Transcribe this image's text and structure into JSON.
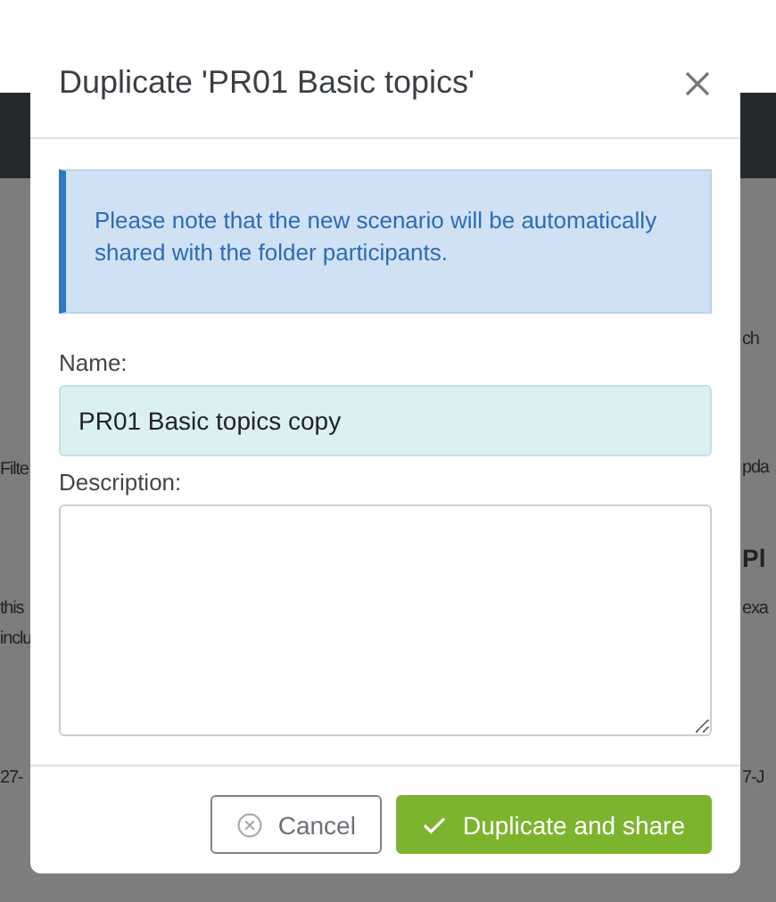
{
  "background": {
    "left_texts": [
      {
        "text": "Filte"
      },
      {
        "text": "this"
      },
      {
        "text": "inclu"
      },
      {
        "text": "27-"
      }
    ],
    "right_texts": [
      {
        "text": "ch",
        "kind": "plain"
      },
      {
        "text": "pda",
        "kind": "plain"
      },
      {
        "text": "Pl",
        "kind": "heading"
      },
      {
        "text": "exa",
        "kind": "plain"
      },
      {
        "text": "7-J",
        "kind": "plain"
      }
    ]
  },
  "dialog": {
    "title": "Duplicate 'PR01 Basic topics'",
    "notice": "Please note that the new scenario will be automatically shared with the folder participants.",
    "name_label": "Name:",
    "name_value": "PR01 Basic topics copy",
    "description_label": "Description:",
    "buttons": [
      {
        "label": "Cancel",
        "kind": "cancel"
      },
      {
        "label": "Duplicate and share",
        "kind": "primary"
      }
    ]
  }
}
